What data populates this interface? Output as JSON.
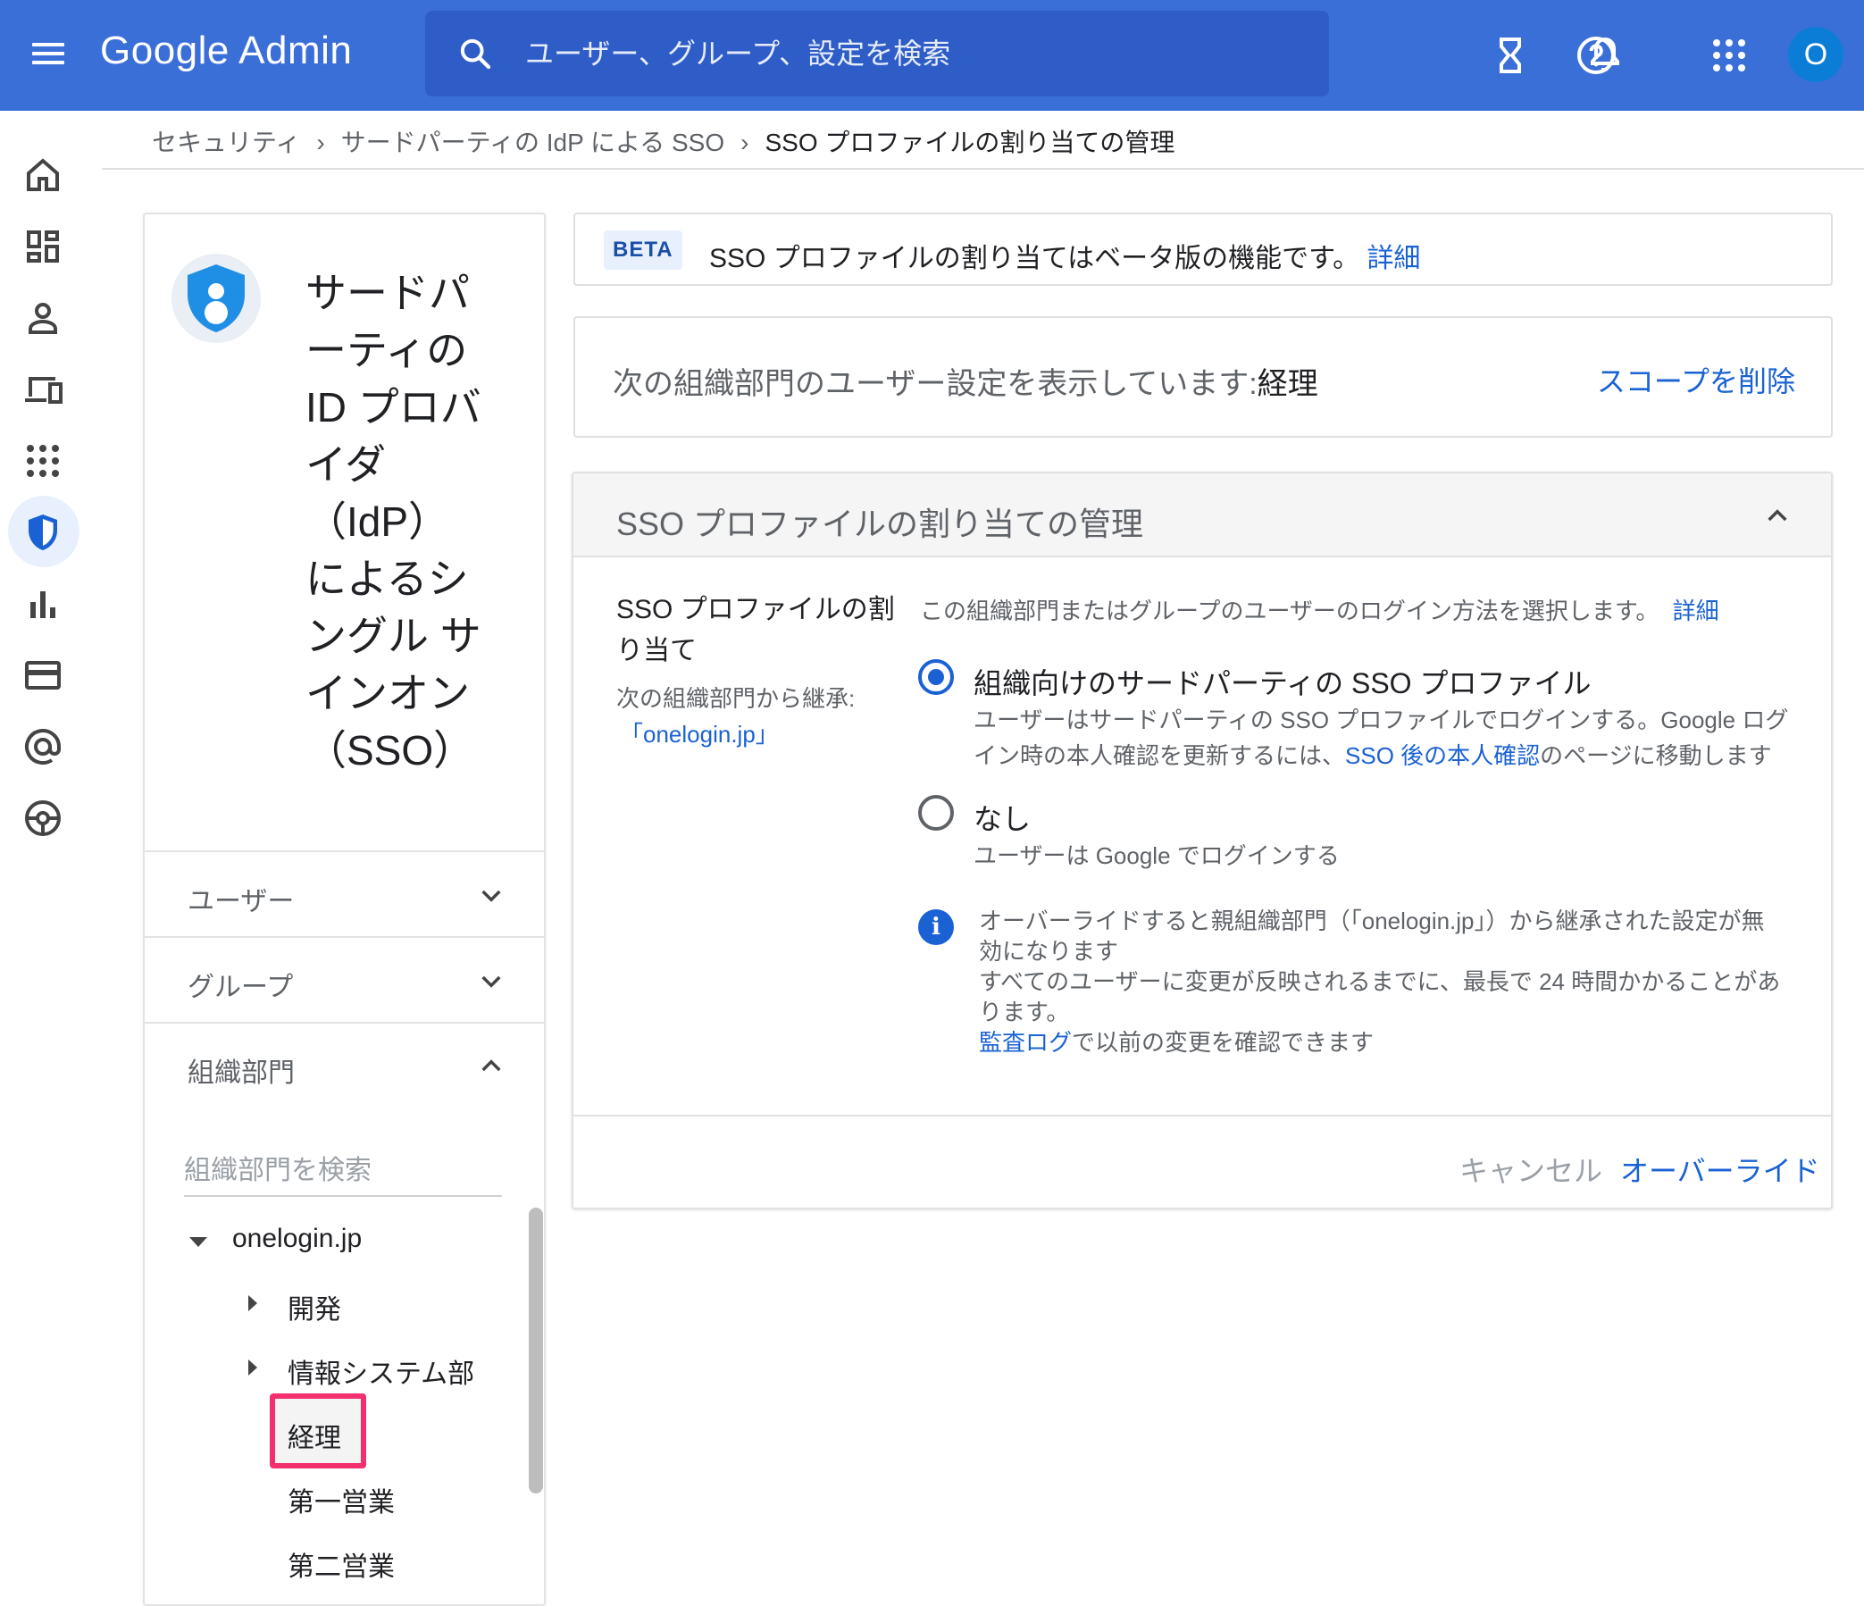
{
  "header": {
    "app_title": "Google Admin",
    "search_placeholder": "ユーザー、グループ、設定を検索",
    "avatar_letter": "O",
    "accent_color": "#3b6fd8"
  },
  "rail": {
    "items": [
      "home-icon",
      "dashboard-icon",
      "user-icon",
      "devices-icon",
      "apps-icon",
      "security-shield-icon",
      "reports-icon",
      "billing-icon",
      "domain-at-icon",
      "support-icon"
    ],
    "active": "security-shield-icon"
  },
  "breadcrumb": {
    "items": [
      "セキュリティ",
      "サードパーティの IdP による SSO",
      "SSO プロファイルの割り当ての管理"
    ]
  },
  "left_panel": {
    "title": "サードパーティの ID プロバイダ（IdP）によるシングル サインオン（SSO）",
    "title_lines": [
      "サードパ",
      "ーティの",
      "ID プロバ",
      "イダ",
      "（IdP）",
      "によるシ",
      "ングル サ",
      "インオン",
      "（SSO）"
    ],
    "sections": [
      "ユーザー",
      "グループ",
      "組織部門"
    ],
    "org_search_placeholder": "組織部門を検索",
    "tree": {
      "root": "onelogin.jp",
      "children": [
        "開発",
        "情報システム部",
        "経理",
        "第一営業",
        "第二営業"
      ],
      "selected": "経理"
    }
  },
  "beta": {
    "badge": "BETA",
    "text": "SSO プロファイルの割り当てはベータ版の機能です。",
    "link": "詳細"
  },
  "scope": {
    "prefix": "次の組織部門のユーザー設定を表示しています:",
    "value": "経理",
    "remove_link": "スコープを削除"
  },
  "main": {
    "title": "SSO プロファイルの割り当ての管理",
    "setting_label": "SSO プロファイルの割り当て",
    "inherit_label": "次の組織部門から継承:",
    "inherit_value": "「onelogin.jp」",
    "description": "この組織部門またはグループのユーザーのログイン方法を選択します。",
    "description_link": "詳細",
    "options": [
      {
        "title": "組織向けのサードパーティの SSO プロファイル",
        "desc_line1": "ユーザーはサードパーティの SSO プロファイルでログインする。Google ログ",
        "desc_line2_prefix": "イン時の本人確認を更新するには、",
        "desc_line2_link": "SSO 後の本人確認",
        "desc_line2_suffix": "のページに移動します",
        "selected": true
      },
      {
        "title": "なし",
        "desc_line1": "ユーザーは Google でログインする",
        "selected": false
      }
    ],
    "info": {
      "line1": "オーバーライドすると親組織部門（「onelogin.jp」）から継承された設定が無",
      "line2": "効になります",
      "line3": "すべてのユーザーに変更が反映されるまでに、最長で 24 時間かかることがあ",
      "line4": "ります。",
      "line5_link": "監査ログ",
      "line5_suffix": "で以前の変更を確認できます"
    },
    "cancel_label": "キャンセル",
    "override_label": "オーバーライド"
  }
}
